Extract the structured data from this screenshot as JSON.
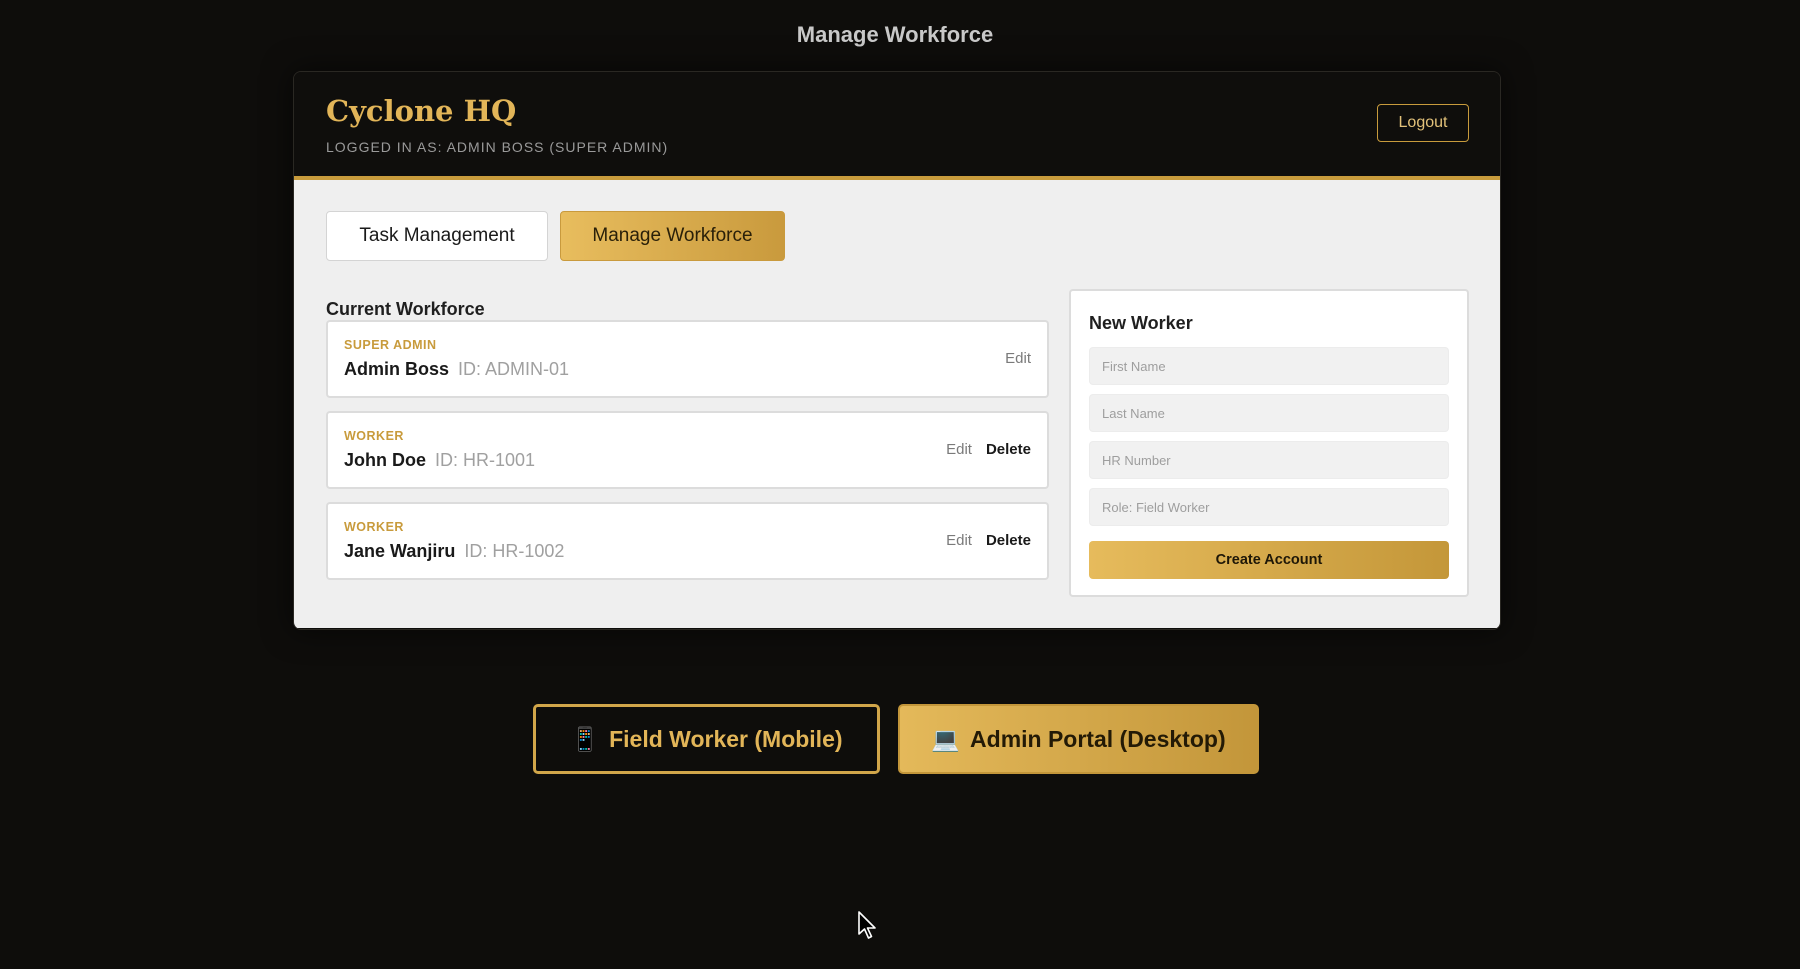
{
  "page_title": "Manage Workforce",
  "header": {
    "brand": "Cyclone HQ",
    "logged_in": "LOGGED IN AS: ADMIN BOSS (SUPER ADMIN)",
    "logout_label": "Logout"
  },
  "tabs": [
    {
      "label": "Task Management",
      "active": false
    },
    {
      "label": "Manage Workforce",
      "active": true
    }
  ],
  "workforce": {
    "title": "Current Workforce",
    "edit_label": "Edit",
    "delete_label": "Delete",
    "members": [
      {
        "role": "SUPER ADMIN",
        "name": "Admin Boss",
        "id": "ID: ADMIN-01",
        "deletable": false
      },
      {
        "role": "WORKER",
        "name": "John Doe",
        "id": "ID: HR-1001",
        "deletable": true
      },
      {
        "role": "WORKER",
        "name": "Jane Wanjiru",
        "id": "ID: HR-1002",
        "deletable": true
      }
    ]
  },
  "new_worker": {
    "title": "New Worker",
    "first_name_placeholder": "First Name",
    "last_name_placeholder": "Last Name",
    "hr_number_placeholder": "HR Number",
    "role_placeholder": "Role: Field Worker",
    "create_label": "Create Account"
  },
  "view_switch": {
    "mobile_icon": "📱",
    "mobile_label": "Field Worker (Mobile)",
    "desktop_icon": "💻",
    "desktop_label": "Admin Portal (Desktop)"
  },
  "colors": {
    "accent": "#c89b3c",
    "brand": "#e2b558",
    "background": "#0e0d0b",
    "content_bg": "#efefef"
  }
}
